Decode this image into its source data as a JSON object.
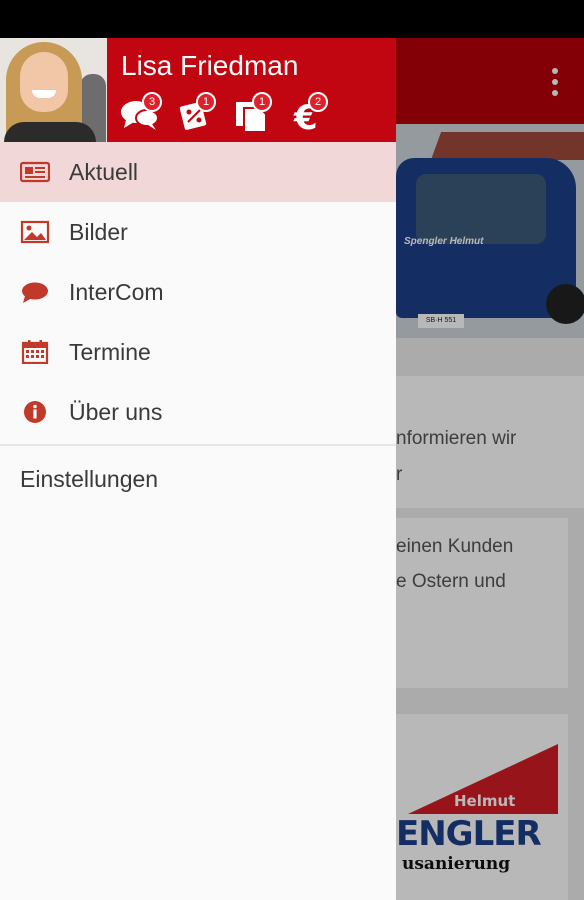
{
  "user": {
    "name": "Lisa Friedman"
  },
  "header_icons": [
    {
      "icon": "chat-bubbles-icon",
      "badge": "3"
    },
    {
      "icon": "coupon-icon",
      "badge": "1"
    },
    {
      "icon": "documents-icon",
      "badge": "1"
    },
    {
      "icon": "euro-icon",
      "badge": "2"
    }
  ],
  "menu": {
    "items": [
      {
        "label": "Aktuell",
        "icon": "newspaper-icon",
        "active": true
      },
      {
        "label": "Bilder",
        "icon": "image-icon",
        "active": false
      },
      {
        "label": "InterCom",
        "icon": "speech-bubble-icon",
        "active": false
      },
      {
        "label": "Termine",
        "icon": "calendar-icon",
        "active": false
      },
      {
        "label": "Über uns",
        "icon": "info-icon",
        "active": false
      }
    ],
    "settings_label": "Einstellungen"
  },
  "background": {
    "text_lines": [
      "nformieren wir",
      "r",
      "einen Kunden",
      "e Ostern und"
    ],
    "van_lettering": "Spengler Helmut",
    "plate": "SB·H 551",
    "logo": {
      "top": "Helmut",
      "name": "ENGLER",
      "sub": "usanierung"
    }
  },
  "colors": {
    "primary": "#c10611",
    "toolbar": "#b8000a",
    "active_item": "#f1d7d7",
    "icon": "#c0392b",
    "badge": "#e0202a"
  }
}
